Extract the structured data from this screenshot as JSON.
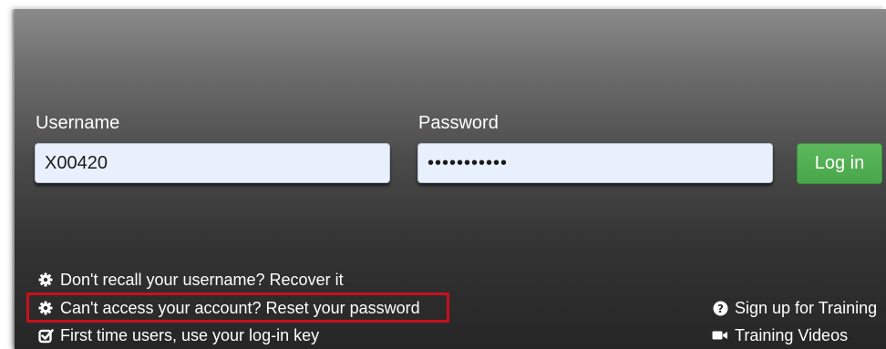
{
  "login_form": {
    "username_label": "Username",
    "username_value": "X00420",
    "password_label": "Password",
    "password_value": "•••••••••••",
    "login_button_label": "Log in"
  },
  "help_links": [
    {
      "icon": "gear-icon",
      "label": "Don't recall your username? Recover it"
    },
    {
      "icon": "gear-icon",
      "label": "Can't access your account? Reset your password",
      "highlighted": true,
      "highlight_color": "#c8101e"
    },
    {
      "icon": "check-square-icon",
      "label": "First time users, use your log-in key"
    }
  ],
  "training_links": [
    {
      "icon": "question-circle-icon",
      "label": "Sign up for Training"
    },
    {
      "icon": "video-camera-icon",
      "label": "Training Videos"
    }
  ],
  "colors": {
    "login_button": "#5cb85c",
    "input_background": "#e8f0fe",
    "text": "#ffffff",
    "highlight": "#c8101e"
  }
}
